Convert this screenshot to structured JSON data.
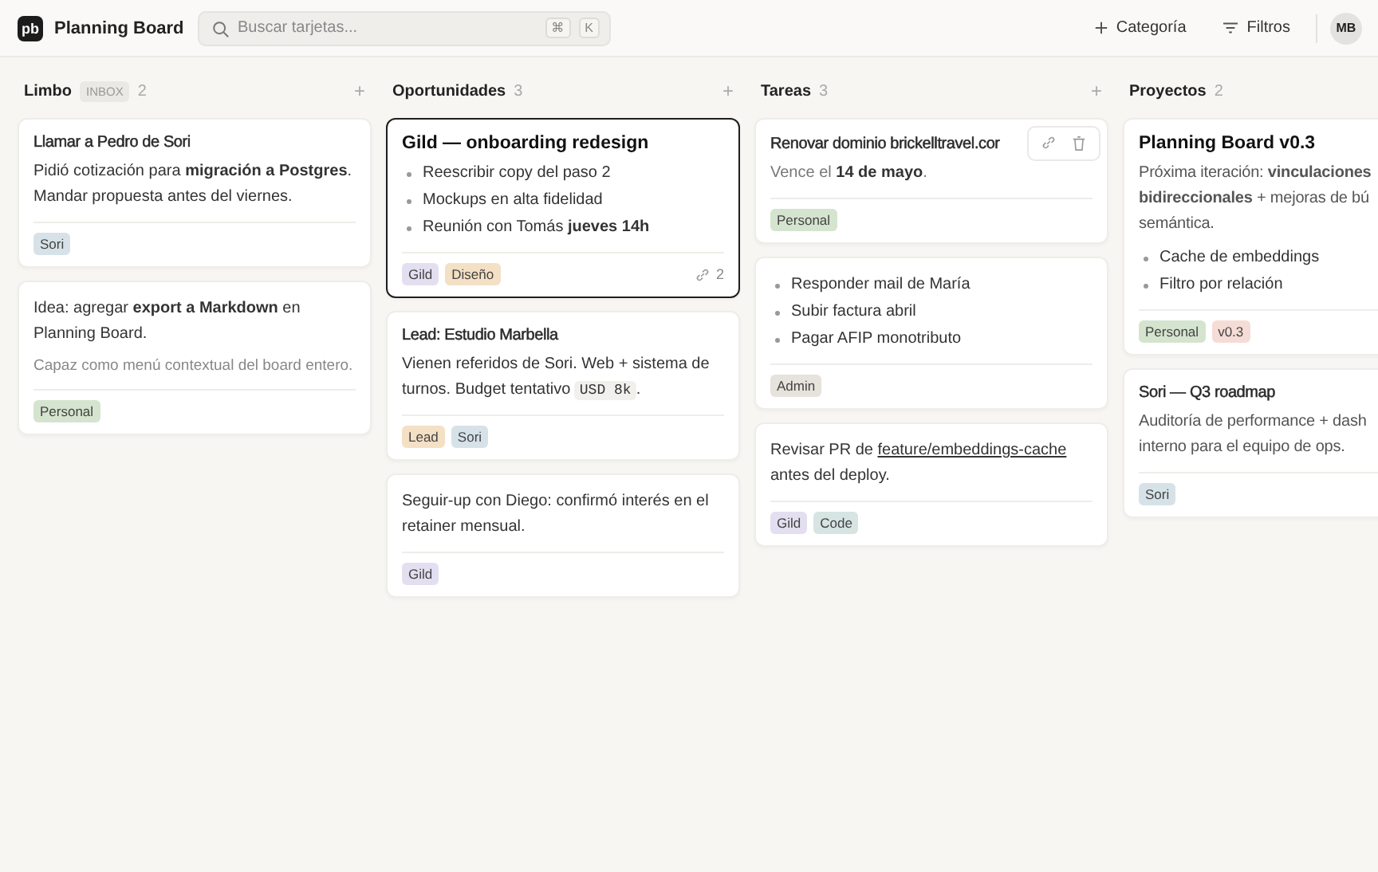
{
  "app": {
    "logo": "pb",
    "title": "Planning Board"
  },
  "search": {
    "placeholder": "Buscar tarjetas...",
    "keys": [
      "⌘",
      "K"
    ]
  },
  "actions": [
    {
      "label": "Categoría",
      "kind": "add"
    },
    {
      "label": "Filtros",
      "kind": "filter"
    }
  ],
  "avatar": "MB",
  "columns": [
    {
      "name": "Limbo",
      "badge": "INBOX",
      "count": "2",
      "add": "+",
      "cards": [
        {
          "title": "Llamar a Pedro de Sori",
          "emphasis": false,
          "selected": false,
          "blocks": [
            {
              "kind": "text",
              "segments": [
                {
                  "kind": "plain",
                  "text": "Pidió cotización para **migración a Postgres**. Mandar propuesta antes del viernes."
                }
              ]
            }
          ],
          "tags": [
            {
              "label": "Sori",
              "color": "#d6e2e8"
            }
          ]
        },
        {
          "selected": false,
          "blocks": [
            {
              "kind": "text",
              "segments": [
                {
                  "kind": "plain",
                  "text": "Idea: agregar **export a Markdown** en Planning Board."
                }
              ]
            },
            {
              "kind": "note",
              "text": "Capaz como menú contextual del board entero."
            }
          ],
          "tags": [
            {
              "label": "Personal",
              "color": "#d5e4cf"
            }
          ]
        }
      ]
    },
    {
      "name": "Oportunidades",
      "count": "3",
      "add": "+",
      "cards": [
        {
          "title": "Gild — onboarding redesign",
          "emphasis": true,
          "selected": true,
          "blocks": [
            {
              "kind": "bullets",
              "items": [
                "Reescribir copy del paso 2",
                "Mockups en alta fidelidad",
                "Reunión con Tomás **jueves 14h**"
              ]
            }
          ],
          "tags": [
            {
              "label": "Gild",
              "color": "#e3dff0"
            },
            {
              "label": "Diseño",
              "color": "#f4e0c4"
            }
          ],
          "links": "2"
        },
        {
          "title": "Lead: Estudio Marbella",
          "emphasis": false,
          "selected": false,
          "blocks": [
            {
              "kind": "text",
              "segments": [
                {
                  "kind": "plain",
                  "text": "Vienen referidos de Sori. Web + sistema de turnos. Budget tentativo "
                },
                {
                  "kind": "code",
                  "text": "USD 8k"
                },
                {
                  "kind": "plain",
                  "text": "."
                }
              ]
            }
          ],
          "tags": [
            {
              "label": "Lead",
              "color": "#f4e0c4"
            },
            {
              "label": "Sori",
              "color": "#d6e2e8"
            }
          ]
        },
        {
          "selected": false,
          "blocks": [
            {
              "kind": "text",
              "segments": [
                {
                  "kind": "plain",
                  "text": "Seguir-up con Diego: confirmó interés en el retainer mensual."
                }
              ]
            }
          ],
          "tags": [
            {
              "label": "Gild",
              "color": "#e3dff0"
            }
          ]
        }
      ]
    },
    {
      "name": "Tareas",
      "count": "3",
      "add": "+",
      "cards": [
        {
          "title": "Renovar dominio brickelltravel.cor",
          "emphasis": false,
          "selected": false,
          "hovered": true,
          "blocks": [
            {
              "kind": "text",
              "segments": [
                {
                  "kind": "muted",
                  "text": "Vence el "
                },
                {
                  "kind": "plain",
                  "text": "**14 de mayo**"
                },
                {
                  "kind": "muted",
                  "text": "."
                }
              ]
            }
          ],
          "tags": [
            {
              "label": "Personal",
              "color": "#d5e4cf"
            }
          ]
        },
        {
          "selected": false,
          "blocks": [
            {
              "kind": "bullets",
              "items": [
                "Responder mail de María",
                "Subir factura abril",
                "Pagar AFIP monotributo"
              ]
            }
          ],
          "tags": [
            {
              "label": "Admin",
              "color": "#e6e2dc"
            }
          ]
        },
        {
          "selected": false,
          "blocks": [
            {
              "kind": "text",
              "segments": [
                {
                  "kind": "plain",
                  "text": "Revisar PR de "
                },
                {
                  "kind": "link",
                  "text": "feature/embeddings-cache"
                },
                {
                  "kind": "plain",
                  "text": " antes del deploy."
                }
              ]
            }
          ],
          "tags": [
            {
              "label": "Gild",
              "color": "#e3dff0"
            },
            {
              "label": "Code",
              "color": "#d6e4e2"
            }
          ]
        }
      ]
    },
    {
      "name": "Proyectos",
      "count": "2",
      "cards": [
        {
          "title": "Planning Board v0.3",
          "emphasis": true,
          "selected": false,
          "blocks": [
            {
              "kind": "lines",
              "lines": [
                "Próxima iteración: **vinculaciones**",
                "**bidireccionales** + mejoras de bú",
                "semántica."
              ]
            },
            {
              "kind": "bullets",
              "items": [
                "Cache de embeddings",
                "Filtro por relación"
              ]
            }
          ],
          "tags": [
            {
              "label": "Personal",
              "color": "#d5e4cf"
            },
            {
              "label": "v0.3",
              "color": "#f6dcd6"
            }
          ]
        },
        {
          "title": "Sori — Q3 roadmap",
          "emphasis": false,
          "selected": false,
          "blocks": [
            {
              "kind": "lines",
              "lines": [
                "Auditoría de performance + dash",
                "interno para el equipo de ops."
              ]
            }
          ],
          "tags": [
            {
              "label": "Sori",
              "color": "#d6e2e8"
            }
          ]
        }
      ]
    }
  ]
}
